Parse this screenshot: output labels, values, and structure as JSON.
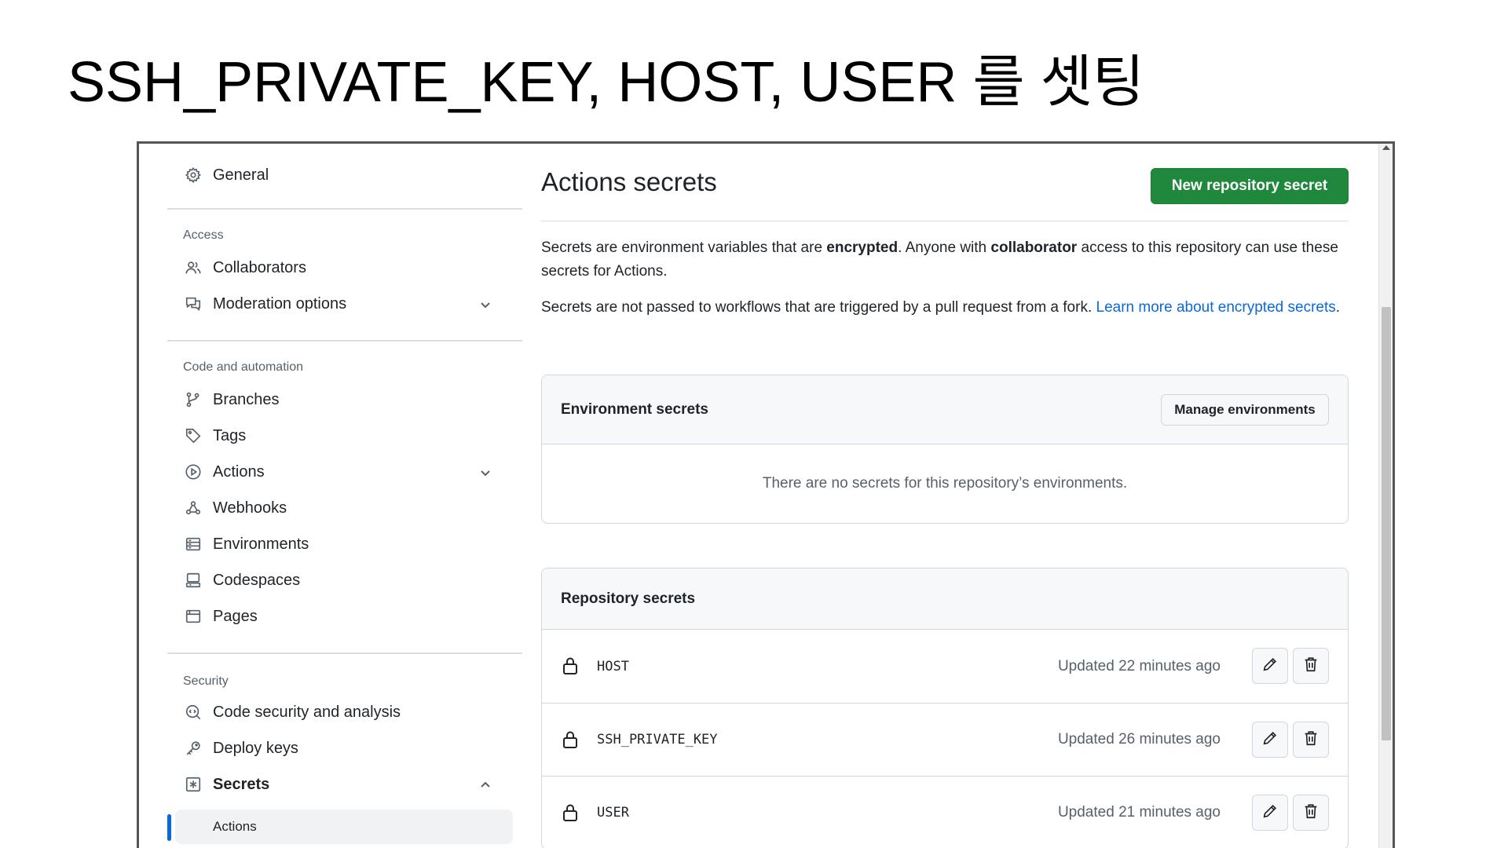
{
  "slide": {
    "title": "SSH_PRIVATE_KEY, HOST, USER 를 셋팅"
  },
  "sidebar": {
    "general": "General",
    "access_label": "Access",
    "collaborators": "Collaborators",
    "moderation": "Moderation options",
    "code_label": "Code and automation",
    "branches": "Branches",
    "tags": "Tags",
    "actions": "Actions",
    "webhooks": "Webhooks",
    "environments": "Environments",
    "codespaces": "Codespaces",
    "pages": "Pages",
    "security_label": "Security",
    "code_security": "Code security and analysis",
    "deploy_keys": "Deploy keys",
    "secrets": "Secrets",
    "secrets_actions": "Actions"
  },
  "main": {
    "title": "Actions secrets",
    "new_secret_button": "New repository secret",
    "intro_p1_a": "Secrets are environment variables that are ",
    "intro_p1_b": "encrypted",
    "intro_p1_c": ". Anyone with ",
    "intro_p1_d": "collaborator",
    "intro_p1_e": " access to this repository can use these secrets for Actions.",
    "intro_p2_a": "Secrets are not passed to workflows that are triggered by a pull request from a fork. ",
    "intro_p2_link": "Learn more about encrypted secrets",
    "intro_p2_end": "."
  },
  "environment_secrets": {
    "title": "Environment secrets",
    "manage_button": "Manage environments",
    "empty": "There are no secrets for this repository’s environments."
  },
  "repository_secrets": {
    "title": "Repository secrets",
    "items": [
      {
        "name": "HOST",
        "updated": "Updated 22 minutes ago"
      },
      {
        "name": "SSH_PRIVATE_KEY",
        "updated": "Updated 26 minutes ago"
      },
      {
        "name": "USER",
        "updated": "Updated 21 minutes ago"
      }
    ]
  },
  "colors": {
    "primary_button": "#1f883d",
    "link": "#0969da",
    "active_marker": "#0969da"
  }
}
